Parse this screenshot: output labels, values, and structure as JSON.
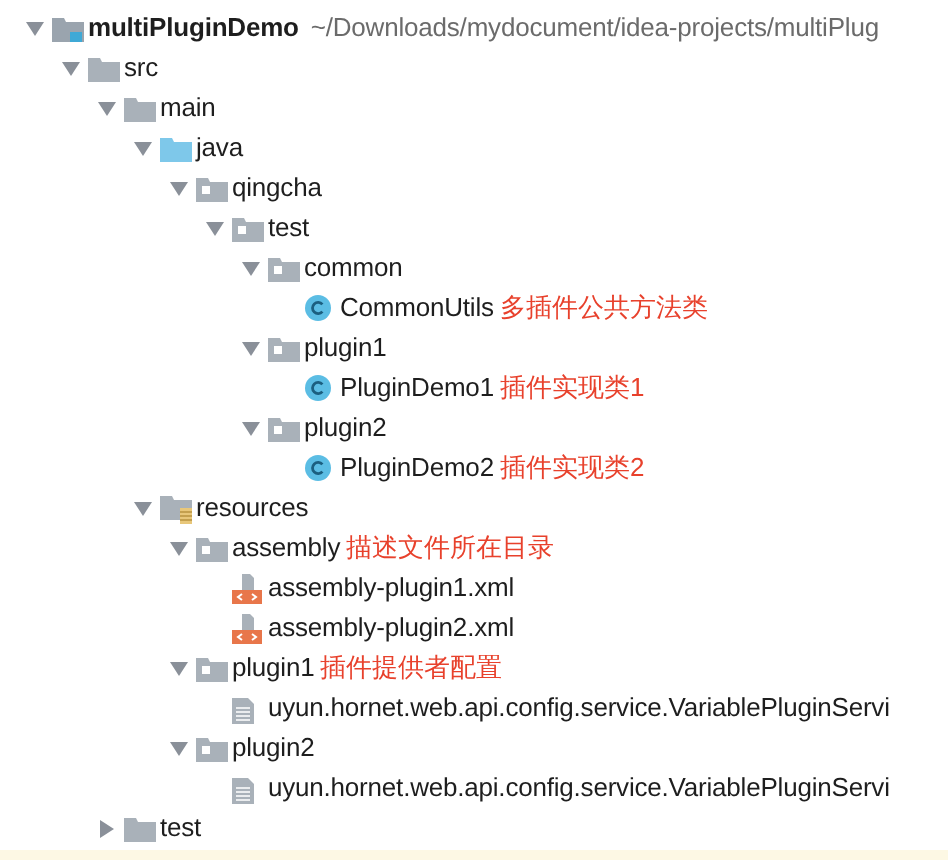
{
  "tree": [
    {
      "kind": "module",
      "label": "multiPluginDemo",
      "path": "~/Downloads/mydocument/idea-projects/multiPlug",
      "expanded": true,
      "children": [
        {
          "kind": "folder",
          "label": "src",
          "expanded": true,
          "children": [
            {
              "kind": "folder",
              "label": "main",
              "expanded": true,
              "children": [
                {
                  "kind": "source_folder",
                  "label": "java",
                  "expanded": true,
                  "children": [
                    {
                      "kind": "package",
                      "label": "qingcha",
                      "expanded": true,
                      "children": [
                        {
                          "kind": "package",
                          "label": "test",
                          "expanded": true,
                          "children": [
                            {
                              "kind": "package",
                              "label": "common",
                              "expanded": true,
                              "children": [
                                {
                                  "kind": "class",
                                  "label": "CommonUtils",
                                  "note": "多插件公共方法类"
                                }
                              ]
                            },
                            {
                              "kind": "package",
                              "label": "plugin1",
                              "expanded": true,
                              "children": [
                                {
                                  "kind": "class",
                                  "label": "PluginDemo1",
                                  "note": "插件实现类1"
                                }
                              ]
                            },
                            {
                              "kind": "package",
                              "label": "plugin2",
                              "expanded": true,
                              "children": [
                                {
                                  "kind": "class",
                                  "label": "PluginDemo2",
                                  "note": "插件实现类2"
                                }
                              ]
                            }
                          ]
                        }
                      ]
                    }
                  ]
                },
                {
                  "kind": "resources_folder",
                  "label": "resources",
                  "expanded": true,
                  "children": [
                    {
                      "kind": "package",
                      "label": "assembly",
                      "note": "描述文件所在目录",
                      "expanded": true,
                      "children": [
                        {
                          "kind": "xml",
                          "label": "assembly-plugin1.xml"
                        },
                        {
                          "kind": "xml",
                          "label": "assembly-plugin2.xml"
                        }
                      ]
                    },
                    {
                      "kind": "package",
                      "label": "plugin1",
                      "note": "插件提供者配置",
                      "expanded": true,
                      "children": [
                        {
                          "kind": "file",
                          "label": "uyun.hornet.web.api.config.service.VariablePluginServi"
                        }
                      ]
                    },
                    {
                      "kind": "package",
                      "label": "plugin2",
                      "expanded": true,
                      "children": [
                        {
                          "kind": "file",
                          "label": "uyun.hornet.web.api.config.service.VariablePluginServi"
                        }
                      ]
                    }
                  ]
                }
              ]
            },
            {
              "kind": "folder",
              "label": "test",
              "expanded": false
            }
          ]
        }
      ]
    }
  ]
}
